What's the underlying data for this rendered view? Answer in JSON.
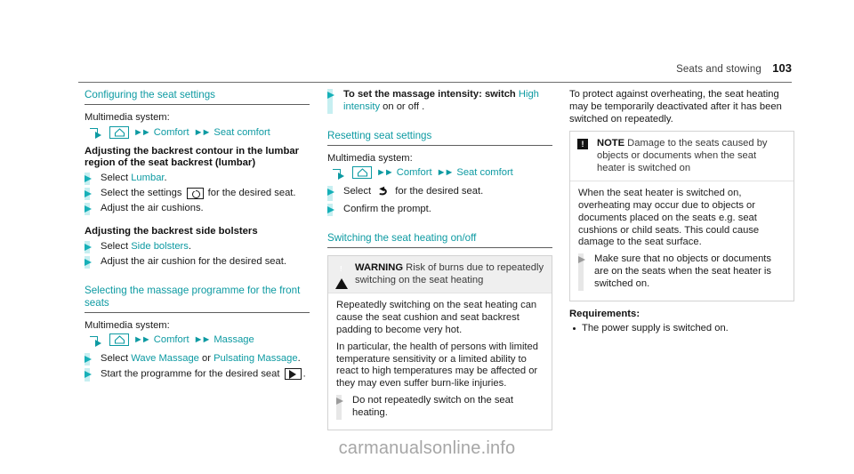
{
  "header": {
    "chapter": "Seats and stowing",
    "page_number": "103"
  },
  "column_1": {
    "heading": "Configuring the seat settings",
    "multimedia_label": "Multimedia system:",
    "nav_path": {
      "arrow_icon": "corner-arrow-icon",
      "home_icon": "home-icon",
      "steps": [
        "Comfort",
        "Seat comfort"
      ],
      "chevron": "»"
    },
    "subheading_lumbar": "Adjusting the backrest contour in the lumbar region of the seat backrest (lumbar)",
    "steps_lumbar": [
      {
        "prefix": "Select ",
        "link": "Lumbar",
        "suffix": "."
      },
      {
        "prefix": "Select the settings ",
        "icon": "settings-gear-icon",
        "suffix": " for the desired seat."
      },
      {
        "prefix": "Adjust the air cushions.",
        "suffix": ""
      }
    ],
    "subheading_bolsters": "Adjusting the backrest side bolsters",
    "steps_bolsters": [
      {
        "prefix": "Select ",
        "link": "Side bolsters",
        "suffix": "."
      },
      {
        "prefix": "Adjust the air cushion for the desired seat.",
        "suffix": ""
      }
    ],
    "heading_massage": "Selecting the massage programme for the front seats",
    "multimedia_label_2": "Multimedia system:",
    "nav_path_2": {
      "steps": [
        "Comfort",
        "Massage"
      ]
    },
    "steps_massage": [
      {
        "prefix": "Select ",
        "link1": "Wave Massage",
        "mid": " or ",
        "link2": "Pulsating Massage",
        "suffix": "."
      },
      {
        "prefix": "Start the programme for the desired seat ",
        "icon": "play-icon",
        "suffix": "."
      }
    ]
  },
  "column_2": {
    "step_intensity": {
      "bold": "To set the massage intensity: switch ",
      "link": "High intensity",
      "suffix": " on or off ."
    },
    "heading_reset": "Resetting seat settings",
    "multimedia_label": "Multimedia system:",
    "nav_path": {
      "steps": [
        "Comfort",
        "Seat comfort"
      ]
    },
    "steps_reset": [
      {
        "prefix": "Select ",
        "icon": "undo-arrow-icon",
        "suffix": " for the desired seat."
      },
      {
        "prefix": "Confirm the prompt.",
        "suffix": ""
      }
    ],
    "heading_heating": "Switching the seat heating on/off",
    "warning": {
      "icon": "warning-triangle-icon",
      "label": "WARNING",
      "title": " Risk of burns due to repeatedly switching on the seat heating",
      "paragraphs": [
        "Repeatedly switching on the seat heating can cause the seat cushion and seat backrest padding to become very hot.",
        "In particular, the health of persons with limited temperature sensitivity or a limited ability to react to high temperatures may be affected or they may even suffer burn-like injuries."
      ],
      "action": "Do not repeatedly switch on the seat heating."
    }
  },
  "column_3": {
    "intro": "To protect against overheating, the seat heating may be temporarily deactivated after it has been switched on repeatedly.",
    "note": {
      "icon": "note-exclamation-icon",
      "label": "NOTE",
      "title": " Damage to the seats caused by objects or documents when the seat heater is switched on",
      "paragraphs": [
        "When the seat heater is switched on, overheating may occur due to objects or documents placed on the seats e.g. seat cushions or child seats. This could cause damage to the seat surface."
      ],
      "action": "Make sure that no objects or documents are on the seats when the seat heater is switched on."
    },
    "requirements_label": "Requirements:",
    "requirements": [
      "The power supply is switched on."
    ]
  },
  "watermark": "carmanualsonline.info",
  "colors": {
    "teal": "#0d9aa2",
    "bullet_teal": "#16b0b8",
    "bullet_bar": "#c7eff1",
    "rule": "#6e6e6e",
    "notice_head_bg": "#efefef"
  }
}
